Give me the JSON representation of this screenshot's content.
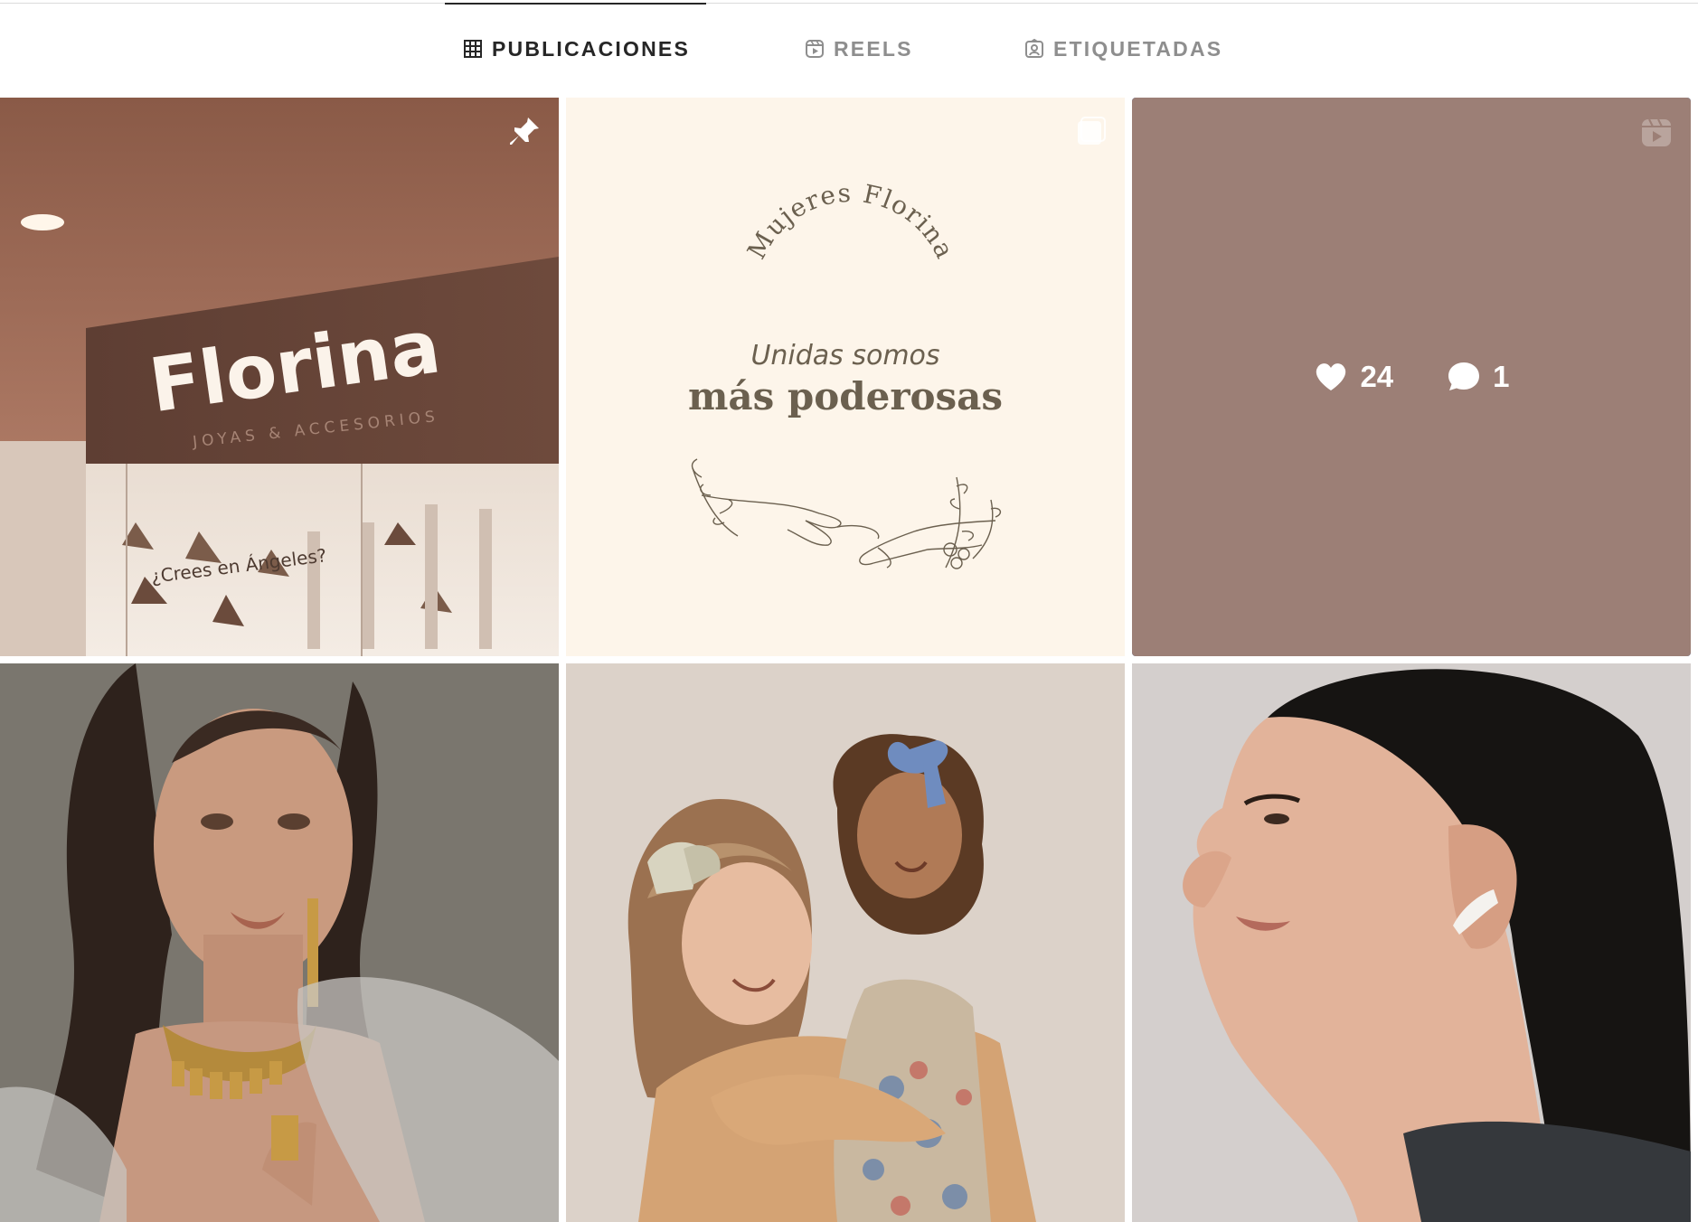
{
  "tabs": [
    {
      "label": "PUBLICACIONES",
      "icon": "grid-icon",
      "active": true
    },
    {
      "label": "REELS",
      "icon": "reels-icon",
      "active": false
    },
    {
      "label": "ETIQUETADAS",
      "icon": "tagged-icon",
      "active": false
    }
  ],
  "posts": [
    {
      "kind": "photo",
      "badge": "pin-icon",
      "sign_text": "Florina",
      "sign_sub": "JOYAS & ACCESORIOS",
      "window_text": "¿Crees en Ángeles?"
    },
    {
      "kind": "graphic",
      "badge": "carousel-icon",
      "arc_text": "Mujeres Florina",
      "line1": "Unidas somos",
      "line2": "más poderosas"
    },
    {
      "kind": "reel",
      "badge": "reels-icon",
      "likes": "24",
      "comments": "1",
      "focused": true
    },
    {
      "kind": "photo",
      "badge": ""
    },
    {
      "kind": "photo",
      "badge": ""
    },
    {
      "kind": "photo",
      "badge": ""
    }
  ],
  "colors": {
    "active_tab": "#262626",
    "inactive_tab": "#8e8e8e",
    "focus_outline": "#3b7de0",
    "reel_overlay": "#9c7f76",
    "graphic_bg": "#fdf5ea",
    "graphic_text": "#6b604f"
  }
}
